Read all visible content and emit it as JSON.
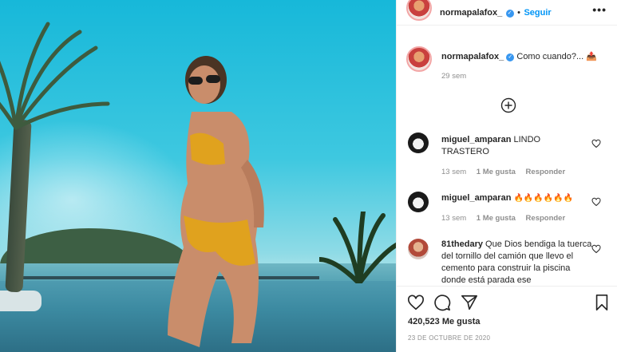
{
  "post": {
    "author": "normapalafox_",
    "verified_mark": "✓",
    "separator": "•",
    "follow_label": "Seguir",
    "more_label": "•••",
    "caption_username": "normapalafox_",
    "caption_text": "Como cuando?...",
    "caption_emoji": "📤",
    "caption_time": "29 sem",
    "likes_count": "420,523",
    "likes_label": "Me gusta",
    "date": "23 DE OCTUBRE DE 2020"
  },
  "comments": [
    {
      "username": "miguel_amparan",
      "text": "LINDO TRASTERO",
      "time": "13 sem",
      "likes": "1 Me gusta",
      "reply": "Responder"
    },
    {
      "username": "miguel_amparan",
      "text": "🔥🔥🔥🔥🔥🔥",
      "time": "13 sem",
      "likes": "1 Me gusta",
      "reply": "Responder"
    },
    {
      "username": "81thedary",
      "text": "Que Dios bendiga la tuerca del tornillo del camión que llevo el cemento para construir la piscina donde está parada ese"
    }
  ],
  "icons": {
    "like": "heart-icon",
    "comment": "comment-icon",
    "share": "share-icon",
    "save": "bookmark-icon",
    "load_more": "plus-circle-icon"
  },
  "colors": {
    "follow": "#0095f6",
    "verified": "#3897f0",
    "muted": "#8e8e8e"
  }
}
